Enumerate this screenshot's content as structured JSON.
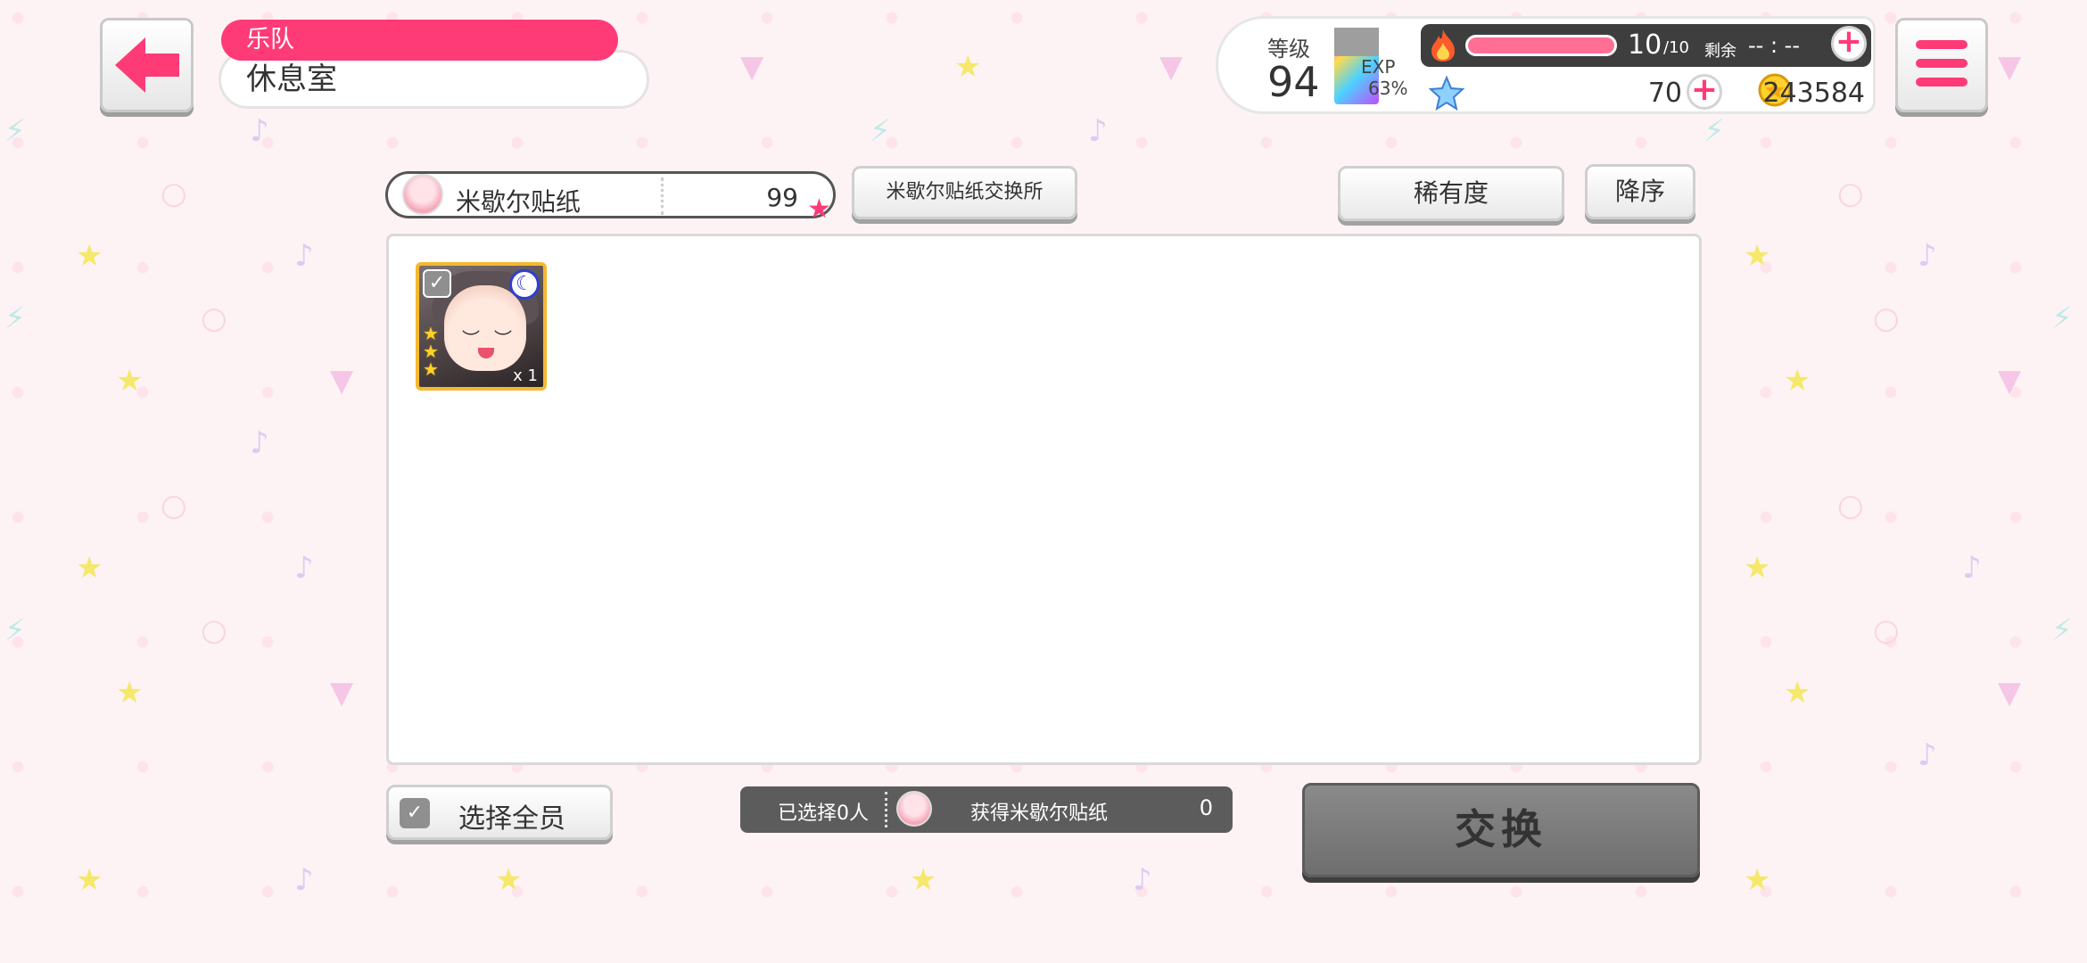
{
  "header": {
    "section": "乐队",
    "title": "休息室"
  },
  "status": {
    "level_label": "等级",
    "level": "94",
    "exp_label": "EXP",
    "exp_percent": "63%",
    "stamina": "10",
    "stamina_max": "/10",
    "remain_label": "剩余",
    "remain_time": "-- : --",
    "gems": "70",
    "coins": "243584"
  },
  "toolbar": {
    "sticker_name": "米歇尔贴纸",
    "sticker_count": "99",
    "exchange_shop": "米歇尔贴纸交换所",
    "sort_rarity": "稀有度",
    "sort_order": "降序"
  },
  "cards": [
    {
      "quantity": "x 1",
      "stars": 3
    }
  ],
  "footer": {
    "select_all": "选择全员",
    "selected": "已选择0人",
    "get_sticker": "获得米歇尔贴纸",
    "get_count": "0",
    "exchange": "交换"
  },
  "colors": {
    "accent": "#ff3b77",
    "background": "#fdf3f5",
    "disabled_button": "#7a7a7a"
  }
}
